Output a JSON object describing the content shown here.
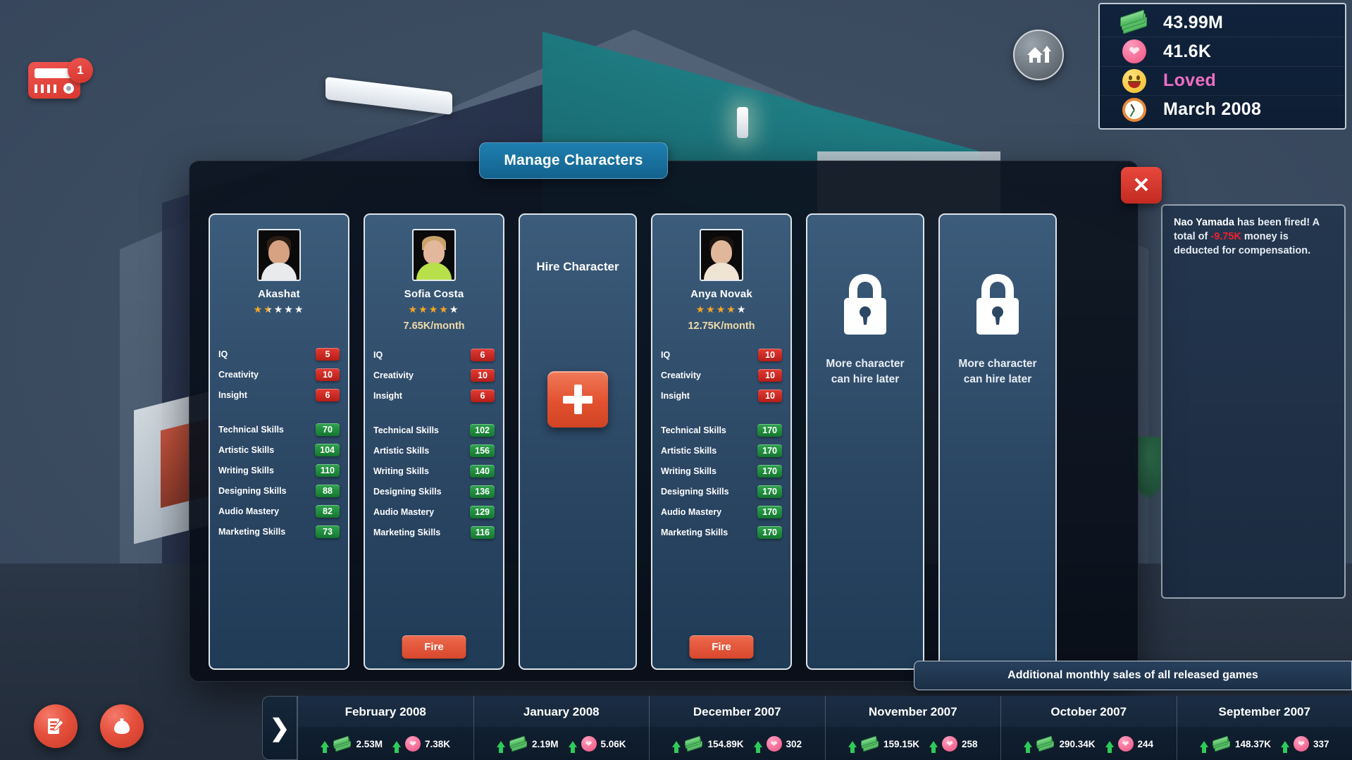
{
  "hud": {
    "notification_card": {
      "icon": "card-icon",
      "badge_count": "1"
    },
    "home_button_icon": "home-upgrade-icon",
    "stats": [
      {
        "icon": "money-icon",
        "value": "43.99M",
        "style": "plain"
      },
      {
        "icon": "heart-icon",
        "value": "41.6K",
        "style": "plain"
      },
      {
        "icon": "smiley-icon",
        "value": "Loved",
        "style": "loved",
        "color": "#f06ec4"
      },
      {
        "icon": "clock-icon",
        "value": "March 2008",
        "style": "plain"
      }
    ]
  },
  "notification": {
    "name": "Nao Yamada",
    "text_before": " has been fired! A total of ",
    "amount": "-9.75K",
    "text_after": " money is deducted for compensation."
  },
  "modal": {
    "title": "Manage Characters",
    "close_label": "✕",
    "cards": [
      {
        "type": "character",
        "name": "Akashat",
        "stars": 1.5,
        "salary": "",
        "fire_label": "",
        "attributes": [
          {
            "label": "IQ",
            "value": "5"
          },
          {
            "label": "Creativity",
            "value": "10"
          },
          {
            "label": "Insight",
            "value": "6"
          }
        ],
        "skills": [
          {
            "label": "Technical Skills",
            "value": "70"
          },
          {
            "label": "Artistic Skills",
            "value": "104"
          },
          {
            "label": "Writing Skills",
            "value": "110"
          },
          {
            "label": "Designing Skills",
            "value": "88"
          },
          {
            "label": "Audio Mastery",
            "value": "82"
          },
          {
            "label": "Marketing Skills",
            "value": "73"
          }
        ]
      },
      {
        "type": "character",
        "name": "Sofia Costa",
        "stars": 4,
        "salary": "7.65K/month",
        "fire_label": "Fire",
        "attributes": [
          {
            "label": "IQ",
            "value": "6"
          },
          {
            "label": "Creativity",
            "value": "10"
          },
          {
            "label": "Insight",
            "value": "6"
          }
        ],
        "skills": [
          {
            "label": "Technical Skills",
            "value": "102"
          },
          {
            "label": "Artistic Skills",
            "value": "156"
          },
          {
            "label": "Writing Skills",
            "value": "140"
          },
          {
            "label": "Designing Skills",
            "value": "136"
          },
          {
            "label": "Audio Mastery",
            "value": "129"
          },
          {
            "label": "Marketing Skills",
            "value": "116"
          }
        ]
      },
      {
        "type": "hire",
        "title": "Hire Character",
        "plus_label": "+"
      },
      {
        "type": "character",
        "name": "Anya Novak",
        "stars": 4,
        "salary": "12.75K/month",
        "fire_label": "Fire",
        "attributes": [
          {
            "label": "IQ",
            "value": "10"
          },
          {
            "label": "Creativity",
            "value": "10"
          },
          {
            "label": "Insight",
            "value": "10"
          }
        ],
        "skills": [
          {
            "label": "Technical Skills",
            "value": "170"
          },
          {
            "label": "Artistic Skills",
            "value": "170"
          },
          {
            "label": "Writing Skills",
            "value": "170"
          },
          {
            "label": "Designing Skills",
            "value": "170"
          },
          {
            "label": "Audio Mastery",
            "value": "170"
          },
          {
            "label": "Marketing Skills",
            "value": "170"
          }
        ]
      },
      {
        "type": "locked",
        "text": "More character\ncan hire later"
      },
      {
        "type": "locked",
        "text": "More character\ncan hire later"
      }
    ]
  },
  "sales_banner": {
    "label": "Additional monthly sales of all released games"
  },
  "left_buttons": [
    {
      "icon": "reports-icon",
      "name": "reports-button"
    },
    {
      "icon": "funds-icon",
      "name": "funds-button"
    }
  ],
  "timeline": {
    "arrow_label": "❯",
    "months": [
      {
        "month": "February 2008",
        "money": "2.53M",
        "fans": "7.38K"
      },
      {
        "month": "January 2008",
        "money": "2.19M",
        "fans": "5.06K"
      },
      {
        "month": "December 2007",
        "money": "154.89K",
        "fans": "302"
      },
      {
        "month": "November 2007",
        "money": "159.15K",
        "fans": "258"
      },
      {
        "month": "October 2007",
        "money": "290.34K",
        "fans": "244"
      },
      {
        "month": "September 2007",
        "money": "148.37K",
        "fans": "337"
      }
    ]
  },
  "colors": {
    "accent_red": "#e5503c",
    "accent_blue": "#1e7fb0",
    "pill_red": "#e23b34",
    "pill_green": "#2fa44f",
    "loved_pink": "#f06ec4",
    "salary_gold": "#efd9a8"
  }
}
